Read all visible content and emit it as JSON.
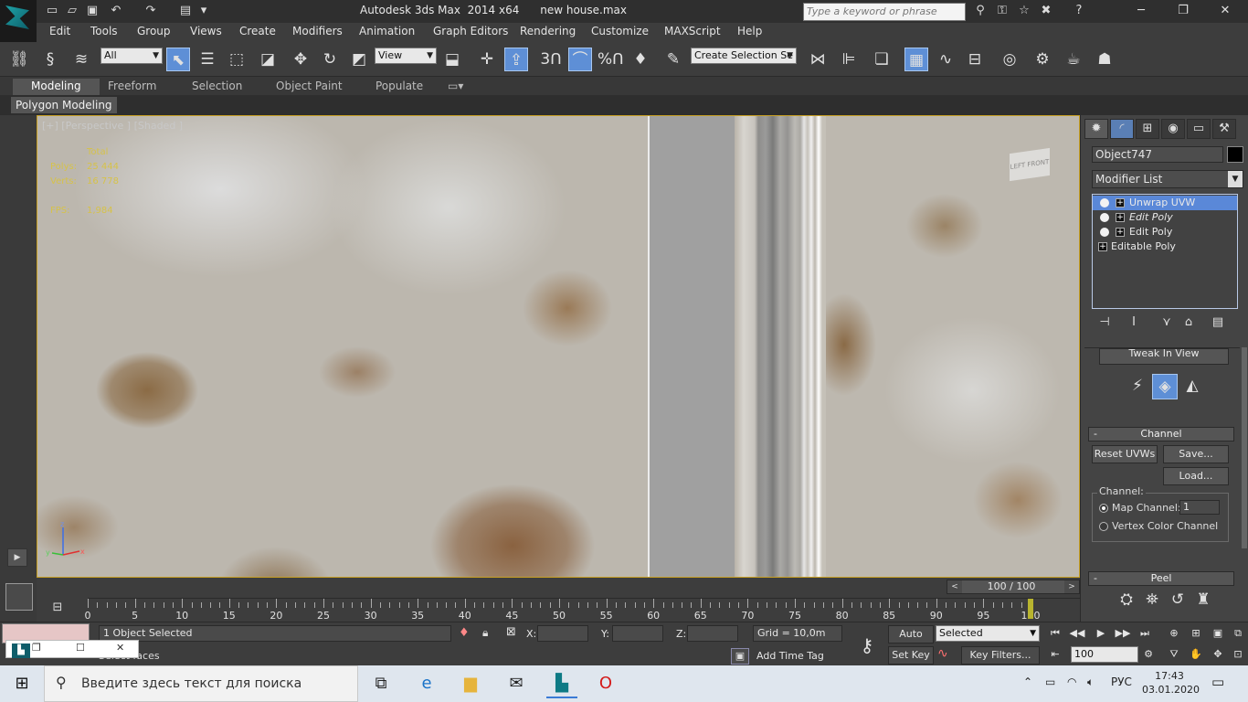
{
  "title": "Autodesk 3ds Max  2014 x64      new house.max",
  "search_placeholder": "Type a keyword or phrase",
  "menu": [
    "Edit",
    "Tools",
    "Group",
    "Views",
    "Create",
    "Modifiers",
    "Animation",
    "Graph Editors",
    "Rendering",
    "Customize",
    "MAXScript",
    "Help"
  ],
  "toolbar": {
    "filter_value": "All",
    "refcoord_value": "View",
    "selection_set": "Create Selection Se",
    "snap_label": "3",
    "angle_snap_label": "%"
  },
  "ribbon": {
    "tabs": [
      "Modeling",
      "Freeform",
      "Selection",
      "Object Paint",
      "Populate"
    ],
    "panel_label": "Polygon Modeling"
  },
  "viewport": {
    "label": "[+] [Perspective ] [Shaded ]",
    "stats": {
      "total_label": "Total",
      "polys_label": "Polys:",
      "polys_value": "25 444",
      "verts_label": "Verts:",
      "verts_value": "16 778",
      "fps_label": "FPS:",
      "fps_value": "1,984"
    },
    "viewcube_text": "LEFT   FRONT",
    "gizmo": {
      "z": "z",
      "y": "y",
      "x": "x"
    }
  },
  "command_panel": {
    "object_name": "Object747",
    "modifier_list": "Modifier List",
    "stack": [
      {
        "label": "Unwrap UVW",
        "selected": true
      },
      {
        "label": "Edit Poly",
        "selected": false,
        "italic": true
      },
      {
        "label": "Edit Poly",
        "selected": false
      },
      {
        "label": "Editable Poly",
        "selected": false
      }
    ],
    "tweak_button": "Tweak In View",
    "channel_rollout": "Channel",
    "reset_uvws": "Reset UVWs",
    "save": "Save...",
    "load": "Load...",
    "channel_group": "Channel:",
    "map_channel": "Map Channel:",
    "map_channel_value": "1",
    "vertex_color_channel": "Vertex Color Channel",
    "peel_rollout": "Peel"
  },
  "timeline": {
    "slider_label": "100 / 100",
    "current_frame": 100,
    "ticks": [
      0,
      5,
      10,
      15,
      20,
      25,
      30,
      35,
      40,
      45,
      50,
      55,
      60,
      65,
      70,
      75,
      80,
      85,
      90,
      95,
      100
    ]
  },
  "status": {
    "selection": "1 Object Selected",
    "prompt": "Select faces",
    "x_label": "X:",
    "y_label": "Y:",
    "z_label": "Z:",
    "grid": "Grid = 10,0m",
    "add_time_tag": "Add Time Tag",
    "auto_key": "Auto Key",
    "set_key": "Set Key",
    "selected_dropdown": "Selected",
    "key_filters": "Key Filters...",
    "frame_value": "100"
  },
  "taskbar": {
    "search_text": "Введите здесь текст для поиска",
    "lang": "РУС",
    "time": "17:43",
    "date": "03.01.2020"
  }
}
